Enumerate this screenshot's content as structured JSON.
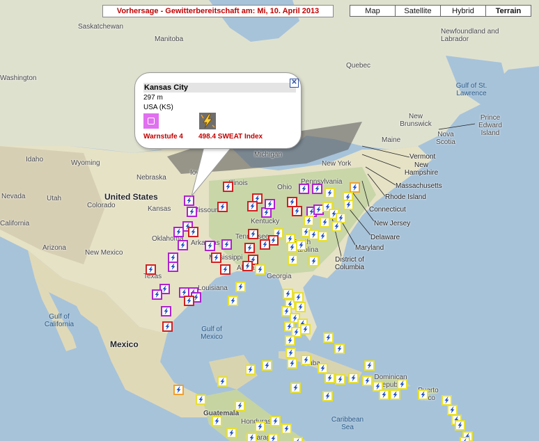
{
  "title": "Vorhersage - Gewitterbereitschaft am: Mi, 10. April 2013",
  "map_types": [
    {
      "label": "Map"
    },
    {
      "label": "Satellite"
    },
    {
      "label": "Hybrid"
    },
    {
      "label": "Terrain",
      "active": true
    }
  ],
  "info_window": {
    "city": "Kansas City",
    "altitude": "297 m",
    "country": "USA (KS)",
    "warn_label": "Warnstufe 4",
    "sweat_label": "498.4  SWEAT Index",
    "close_symbol": "✕"
  },
  "labels": {
    "saskatchewan": "Saskatchewan",
    "manitoba": "Manitoba",
    "quebec": "Quebec",
    "newfoundland": "Newfoundland and Labrador",
    "gulf_st_lawrence": "Gulf of St. Lawrence",
    "new_brunswick": "New Brunswick",
    "prince_edward": "Prince Edward Island",
    "nova_scotia": "Nova Scotia",
    "maine": "Maine",
    "vermont": "Vermont",
    "new_hampshire": "New Hampshire",
    "massachusetts": "Massachusetts",
    "rhode_island": "Rhode Island",
    "connecticut": "Connecticut",
    "new_jersey": "New Jersey",
    "delaware": "Delaware",
    "maryland": "Maryland",
    "dc": "District of Columbia",
    "michigan": "Michigan",
    "new_york": "New York",
    "pennsylvania": "Pennsylvania",
    "ohio": "Ohio",
    "illinois": "Illinois",
    "iowa": "Iowa",
    "nebraska": "Nebraska",
    "kansas": "Kansas",
    "missouri": "Missouri",
    "kentucky": "Kentucky",
    "tennessee": "Tennessee",
    "oklahoma": "Oklahoma",
    "arkansas": "Arkansas",
    "mississippi": "Mississippi",
    "alabama": "Alabama",
    "georgia": "Georgia",
    "south_carolina": "South Carolina",
    "texas": "Texas",
    "louisiana": "Louisiana",
    "idaho": "Idaho",
    "wyoming": "Wyoming",
    "nevada": "Nevada",
    "utah": "Utah",
    "colorado": "Colorado",
    "new_mexico": "New Mexico",
    "arizona": "Arizona",
    "california": "California",
    "washington": "Washington",
    "united_states": "United States",
    "mexico": "Mexico",
    "gulf_mexico": "Gulf of Mexico",
    "gulf_california": "Gulf of California",
    "guatemala": "Guatemala",
    "honduras": "Honduras",
    "nicaragua": "Nicaragua",
    "cuba": "Cuba",
    "dominican": "Dominican Republic",
    "puerto_rico": "Puerto Rico",
    "caribbean": "Caribbean Sea"
  }
}
